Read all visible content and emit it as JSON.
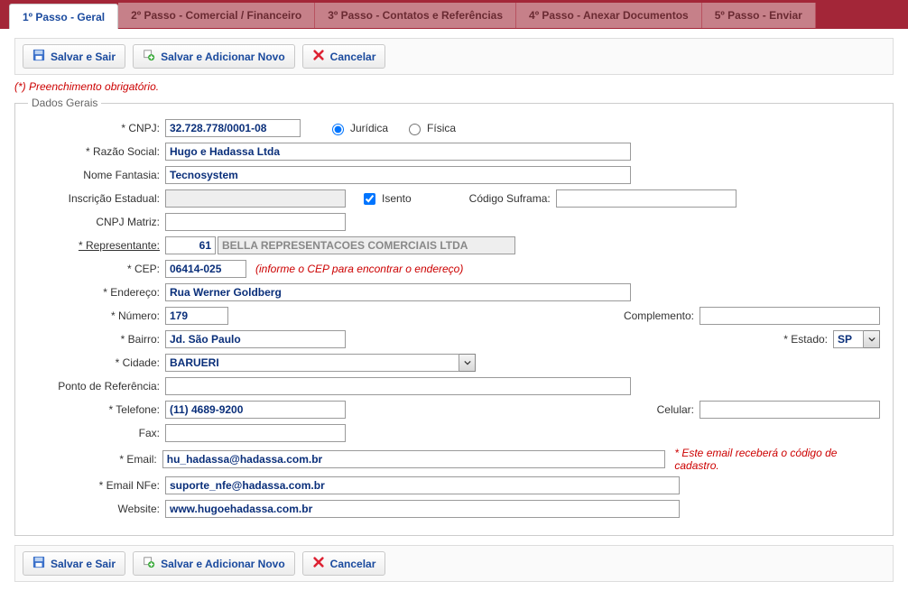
{
  "tabs": [
    {
      "label": "1º Passo - Geral",
      "active": true
    },
    {
      "label": "2º Passo - Comercial / Financeiro"
    },
    {
      "label": "3º Passo - Contatos e Referências"
    },
    {
      "label": "4º Passo - Anexar Documentos"
    },
    {
      "label": "5º Passo - Enviar"
    }
  ],
  "toolbar": {
    "save_exit": "Salvar e Sair",
    "save_add": "Salvar e Adicionar Novo",
    "cancel": "Cancelar"
  },
  "required_note": "(*) Preenchimento obrigatório.",
  "group": {
    "legend": "Dados Gerais",
    "labels": {
      "cnpj": "* CNPJ:",
      "razao": "* Razão Social:",
      "fantasia": "Nome Fantasia:",
      "inscricao": "Inscrição Estadual:",
      "isento": "Isento",
      "suframa": "Código Suframa:",
      "cnpj_matriz": "CNPJ Matriz:",
      "representante": "* Representante:",
      "cep": "* CEP:",
      "cep_hint": "(informe o CEP para encontrar o endereço)",
      "endereco": "* Endereço:",
      "numero": "* Número:",
      "complemento": "Complemento:",
      "bairro": "* Bairro:",
      "estado": "* Estado:",
      "cidade": "* Cidade:",
      "ponto_ref": "Ponto de Referência:",
      "telefone": "* Telefone:",
      "celular": "Celular:",
      "fax": "Fax:",
      "email": "* Email:",
      "email_hint": "* Este email receberá o código de cadastro.",
      "email_nfe": "* Email NFe:",
      "website": "Website:"
    },
    "pessoa": {
      "juridica": "Jurídica",
      "fisica": "Física",
      "selected": "juridica"
    },
    "values": {
      "cnpj": "32.728.778/0001-08",
      "razao": "Hugo e Hadassa Ltda",
      "fantasia": "Tecnosystem",
      "inscricao": "",
      "isento_checked": true,
      "suframa": "",
      "cnpj_matriz": "",
      "representante_code": "61",
      "representante_name": "BELLA REPRESENTACOES COMERCIAIS LTDA",
      "cep": "06414-025",
      "endereco": "Rua Werner Goldberg",
      "numero": "179",
      "complemento": "",
      "bairro": "Jd. São Paulo",
      "estado": "SP",
      "cidade": "BARUERI",
      "ponto_ref": "",
      "telefone": "(11) 4689-9200",
      "celular": "",
      "fax": "",
      "email": "hu_hadassa@hadassa.com.br",
      "email_nfe": "suporte_nfe@hadassa.com.br",
      "website": "www.hugoehadassa.com.br"
    }
  }
}
